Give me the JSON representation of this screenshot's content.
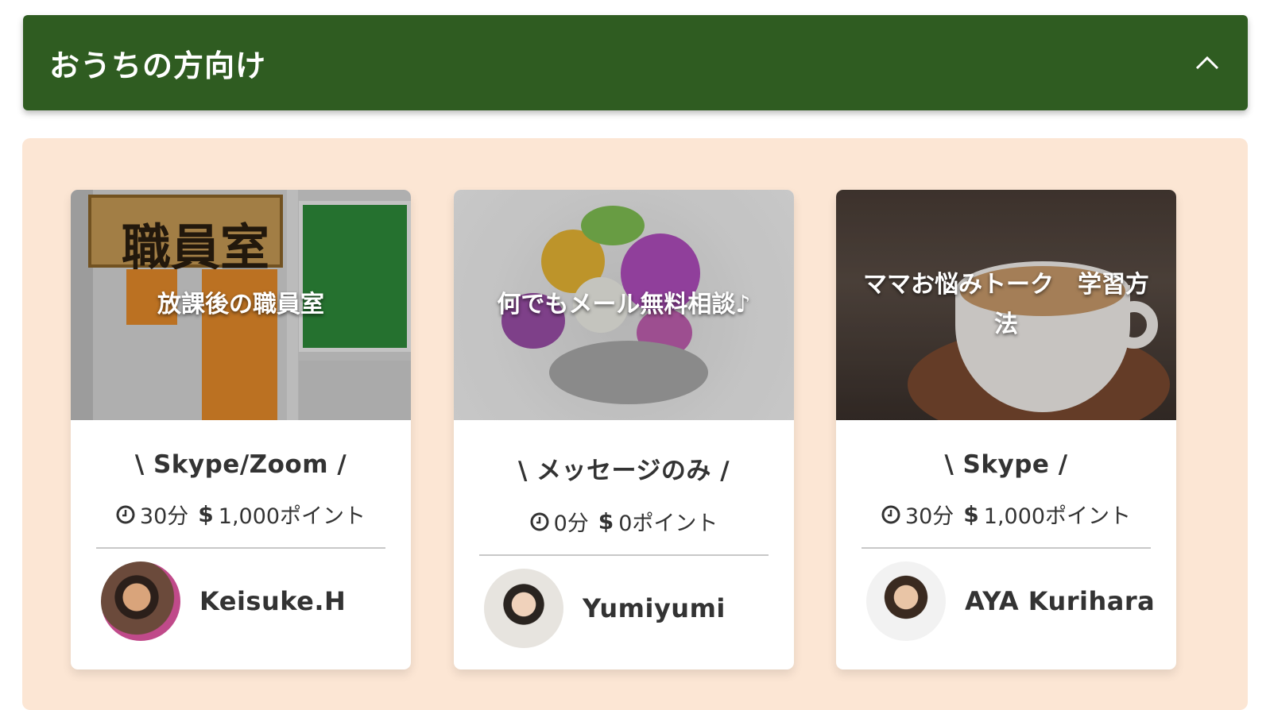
{
  "section": {
    "title": "おうちの方向け"
  },
  "cards": [
    {
      "image_title": "放課後の職員室",
      "image_sign": "職員室",
      "format": "\\ Skype/Zoom /",
      "duration": "30分",
      "price": "1,000ポイント",
      "author": "Keisuke.H"
    },
    {
      "image_title": "何でもメール無料相談♪",
      "format": "\\ メッセージのみ /",
      "duration": "0分",
      "price": "0ポイント",
      "author": "Yumiyumi"
    },
    {
      "image_title": "ママお悩みトーク　学習方法",
      "format": "\\ Skype /",
      "duration": "30分",
      "price": "1,000ポイント",
      "author": "AYA Kurihara"
    }
  ],
  "icons": {
    "collapse": "chevron-up-icon",
    "duration": "clock-icon",
    "price": "dollar-icon"
  },
  "colors": {
    "header_bg": "#2f5c21",
    "panel_bg": "#fce6d4"
  }
}
